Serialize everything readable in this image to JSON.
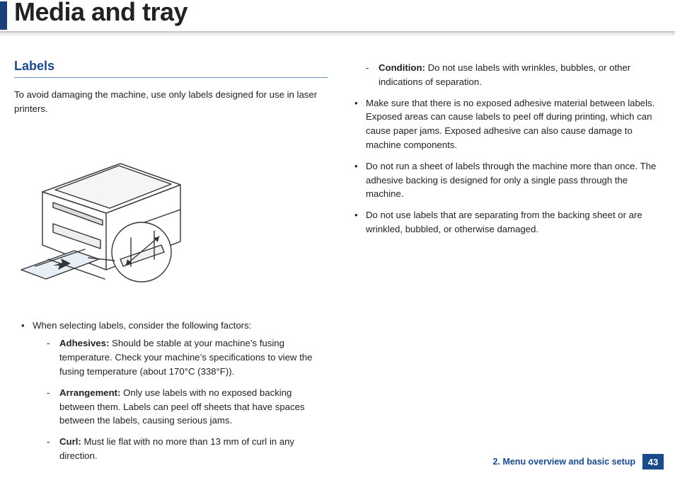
{
  "title": "Media and tray",
  "section_heading": "Labels",
  "intro": "To avoid damaging the machine, use only labels designed for use in laser printers.",
  "left": {
    "factors_intro": "When selecting labels, consider the following factors:",
    "factors": [
      {
        "term": "Adhesives:",
        "text": " Should be stable at your machine’s fusing temperature. Check your machine’s specifications to view the fusing temperature (about 170°C (338°F))."
      },
      {
        "term": "Arrangement:",
        "text": " Only use labels with no exposed backing between them. Labels can peel off sheets that have spaces between the labels, causing serious jams."
      },
      {
        "term": "Curl:",
        "text": " Must lie flat with no more than 13 mm of curl in any direction."
      }
    ]
  },
  "right": {
    "condition": {
      "term": "Condition:",
      "text": " Do not use labels with wrinkles, bubbles, or other indications of separation."
    },
    "bullets": [
      "Make sure that there is no exposed adhesive material between labels. Exposed areas can cause labels to peel off during printing, which can cause paper jams. Exposed adhesive can also cause damage to machine components.",
      "Do not run a sheet of labels through the machine more than once. The adhesive backing is designed for only a single pass through the machine.",
      "Do not use labels that are separating from the backing sheet or are wrinkled, bubbled, or otherwise damaged."
    ]
  },
  "footer": {
    "chapter": "2. Menu overview and basic setup",
    "page": "43"
  }
}
